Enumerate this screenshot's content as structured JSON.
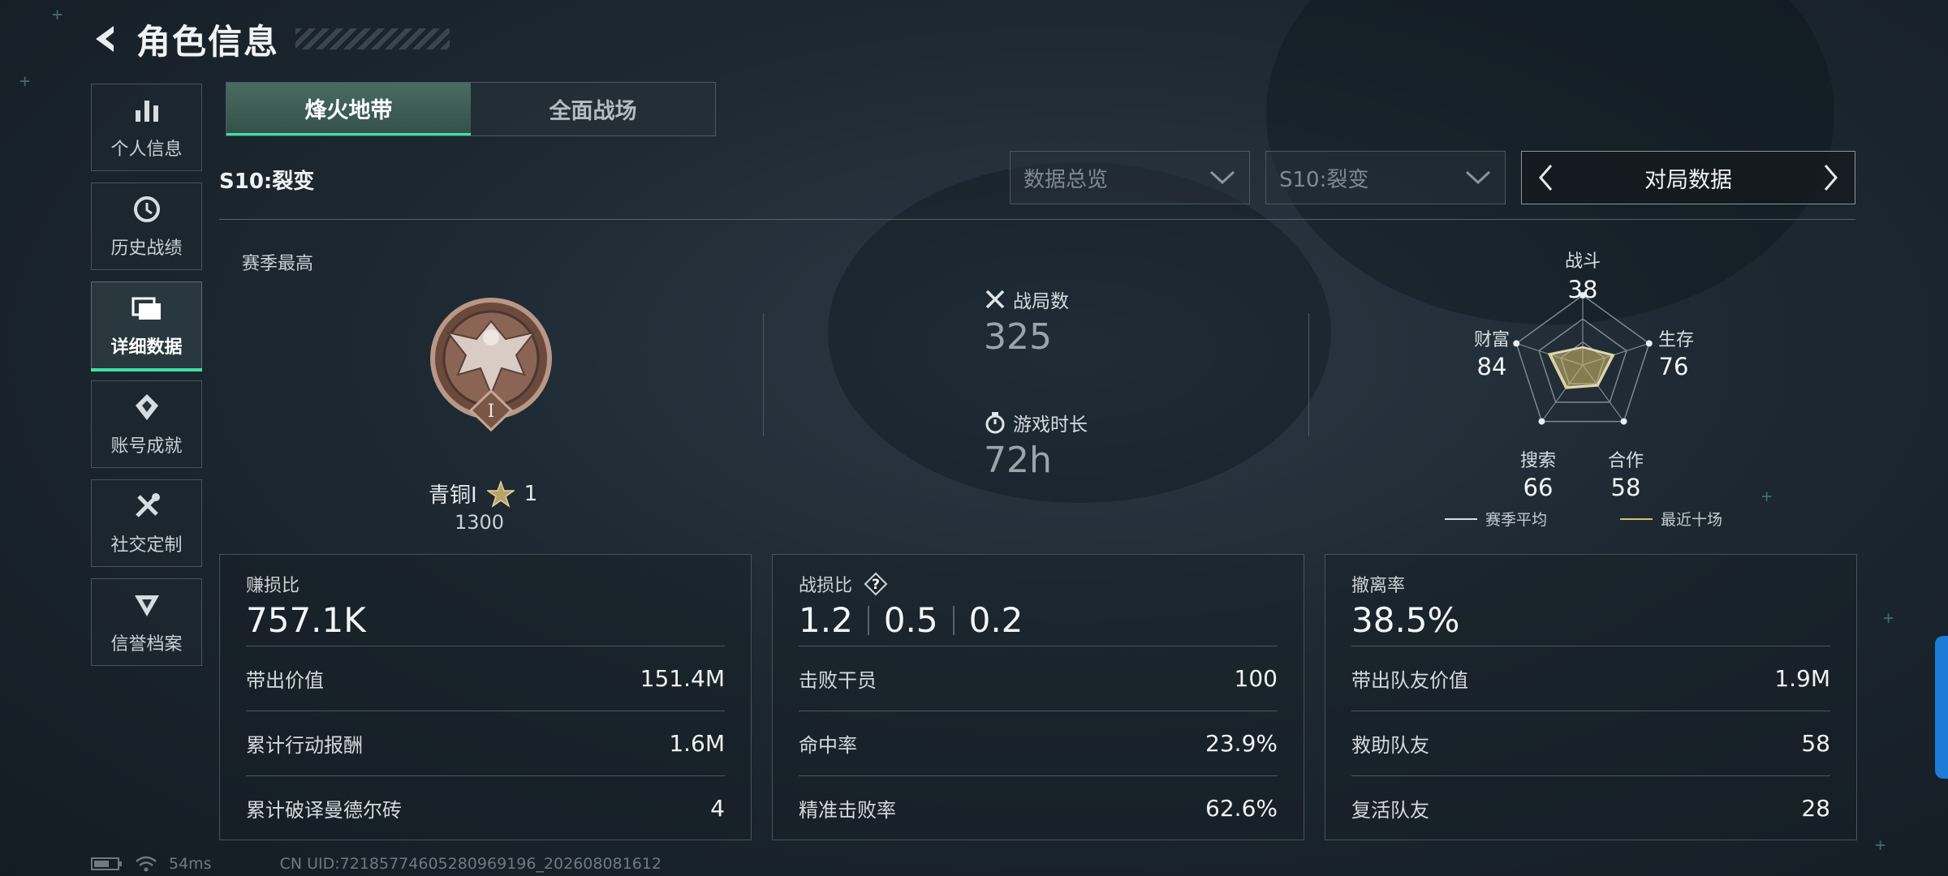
{
  "header": {
    "title": "角色信息"
  },
  "sidebar": {
    "items": [
      {
        "label": "个人信息",
        "icon": "bar-chart-icon"
      },
      {
        "label": "历史战绩",
        "icon": "history-clock-icon"
      },
      {
        "label": "详细数据",
        "icon": "folder-icon",
        "active": true
      },
      {
        "label": "账号成就",
        "icon": "achievement-icon"
      },
      {
        "label": "社交定制",
        "icon": "wrench-screwdriver-icon"
      },
      {
        "label": "信誉档案",
        "icon": "credit-shield-icon"
      }
    ]
  },
  "mode_tabs": [
    {
      "label": "烽火地带",
      "active": true
    },
    {
      "label": "全面战场",
      "active": false
    }
  ],
  "season": {
    "label": "S10:裂变"
  },
  "filters": {
    "dropdown1": "数据总览",
    "dropdown2": "S10:裂变",
    "pager_label": "对局数据"
  },
  "summary": {
    "season_high_label": "赛季最高",
    "rank_name": "青铜Ⅰ",
    "rank_stars": "1",
    "rank_score": "1300",
    "rank_numeral": "I",
    "matches_label": "战局数",
    "matches_value": "325",
    "playtime_label": "游戏时长",
    "playtime_value": "72h"
  },
  "radar": {
    "axes": [
      {
        "label": "战斗",
        "value": "38"
      },
      {
        "label": "生存",
        "value": "76"
      },
      {
        "label": "合作",
        "value": "58"
      },
      {
        "label": "搜索",
        "value": "66"
      },
      {
        "label": "财富",
        "value": "84"
      }
    ],
    "legend": [
      {
        "label": "赛季平均",
        "color": "#d9dfe3"
      },
      {
        "label": "最近十场",
        "color": "#d9c06a"
      }
    ]
  },
  "cards": [
    {
      "title": "赚损比",
      "main": "757.1K",
      "rows": [
        {
          "label": "带出价值",
          "value": "151.4M"
        },
        {
          "label": "累计行动报酬",
          "value": "1.6M"
        },
        {
          "label": "累计破译曼德尔砖",
          "value": "4"
        }
      ]
    },
    {
      "title": "战损比",
      "mains": [
        "1.2",
        "0.5",
        "0.2"
      ],
      "rows": [
        {
          "label": "击败干员",
          "value": "100"
        },
        {
          "label": "命中率",
          "value": "23.9%"
        },
        {
          "label": "精准击败率",
          "value": "62.6%"
        }
      ]
    },
    {
      "title": "撤离率",
      "main": "38.5%",
      "rows": [
        {
          "label": "带出队友价值",
          "value": "1.9M"
        },
        {
          "label": "救助队友",
          "value": "58"
        },
        {
          "label": "复活队友",
          "value": "28"
        }
      ]
    }
  ],
  "status": {
    "ping": "54ms",
    "uid": "CN UID:721857746052809691​96_202608081612"
  },
  "colors": {
    "accent": "#3fe0a6",
    "radar_fill": "#d9c06a"
  }
}
